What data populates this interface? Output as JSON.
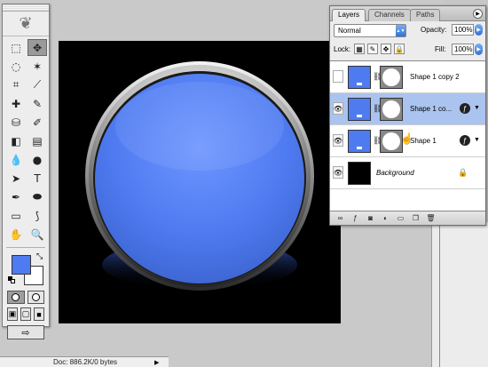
{
  "status_bar": {
    "doc_info": "Doc: 886.2K/0 bytes"
  },
  "toolbox": {
    "tools": [
      {
        "name": "marquee-tool-icon",
        "glyph": "⬚",
        "active": false
      },
      {
        "name": "move-tool-icon",
        "glyph": "✥",
        "active": true
      },
      {
        "name": "lasso-tool-icon",
        "glyph": "◌",
        "active": false
      },
      {
        "name": "magic-wand-icon",
        "glyph": "✶",
        "active": false
      },
      {
        "name": "crop-tool-icon",
        "glyph": "⌗",
        "active": false
      },
      {
        "name": "slice-tool-icon",
        "glyph": "⟋",
        "active": false
      },
      {
        "name": "healing-brush-icon",
        "glyph": "✚",
        "active": false
      },
      {
        "name": "brush-tool-icon",
        "glyph": "✎",
        "active": false
      },
      {
        "name": "clone-stamp-icon",
        "glyph": "⛁",
        "active": false
      },
      {
        "name": "history-brush-icon",
        "glyph": "✐",
        "active": false
      },
      {
        "name": "eraser-tool-icon",
        "glyph": "◧",
        "active": false
      },
      {
        "name": "gradient-tool-icon",
        "glyph": "▤",
        "active": false
      },
      {
        "name": "blur-tool-icon",
        "glyph": "💧",
        "active": false
      },
      {
        "name": "dodge-tool-icon",
        "glyph": "●",
        "active": false
      },
      {
        "name": "path-selection-icon",
        "glyph": "➤",
        "active": false
      },
      {
        "name": "type-tool-icon",
        "glyph": "T",
        "active": false
      },
      {
        "name": "pen-tool-icon",
        "glyph": "✒",
        "active": false
      },
      {
        "name": "shape-tool-icon",
        "glyph": "⬬",
        "active": false
      },
      {
        "name": "notes-tool-icon",
        "glyph": "▭",
        "active": false
      },
      {
        "name": "eyedropper-icon",
        "glyph": "⟆",
        "active": false
      },
      {
        "name": "hand-tool-icon",
        "glyph": "✋",
        "active": false
      },
      {
        "name": "zoom-tool-icon",
        "glyph": "🔍",
        "active": false
      }
    ],
    "foreground_color": "#4f7bf1",
    "background_color": "#ffffff",
    "swap_glyph": "⤡",
    "jump_glyph": "⇨"
  },
  "layers_palette": {
    "tabs": [
      "Layers",
      "Channels",
      "Paths"
    ],
    "active_tab": "Layers",
    "blend_mode": "Normal",
    "opacity_label": "Opacity:",
    "opacity_value": "100%",
    "lock_label": "Lock:",
    "fill_label": "Fill:",
    "fill_value": "100%",
    "layers": [
      {
        "name": "Shape 1 copy 2",
        "visible": false,
        "selected": false,
        "type": "shape",
        "fx": false
      },
      {
        "name": "Shape 1 co...",
        "visible": true,
        "selected": true,
        "type": "shape",
        "fx": true
      },
      {
        "name": "Shape 1",
        "visible": true,
        "selected": false,
        "type": "shape",
        "fx": true
      },
      {
        "name": "Background",
        "visible": true,
        "selected": false,
        "type": "background",
        "locked": true
      }
    ],
    "accent_color": "#aac4ef"
  },
  "colors": {
    "canvas_bg": "#000000",
    "button_blue": "#4f7bf1",
    "workspace": "#c9c9c9"
  }
}
